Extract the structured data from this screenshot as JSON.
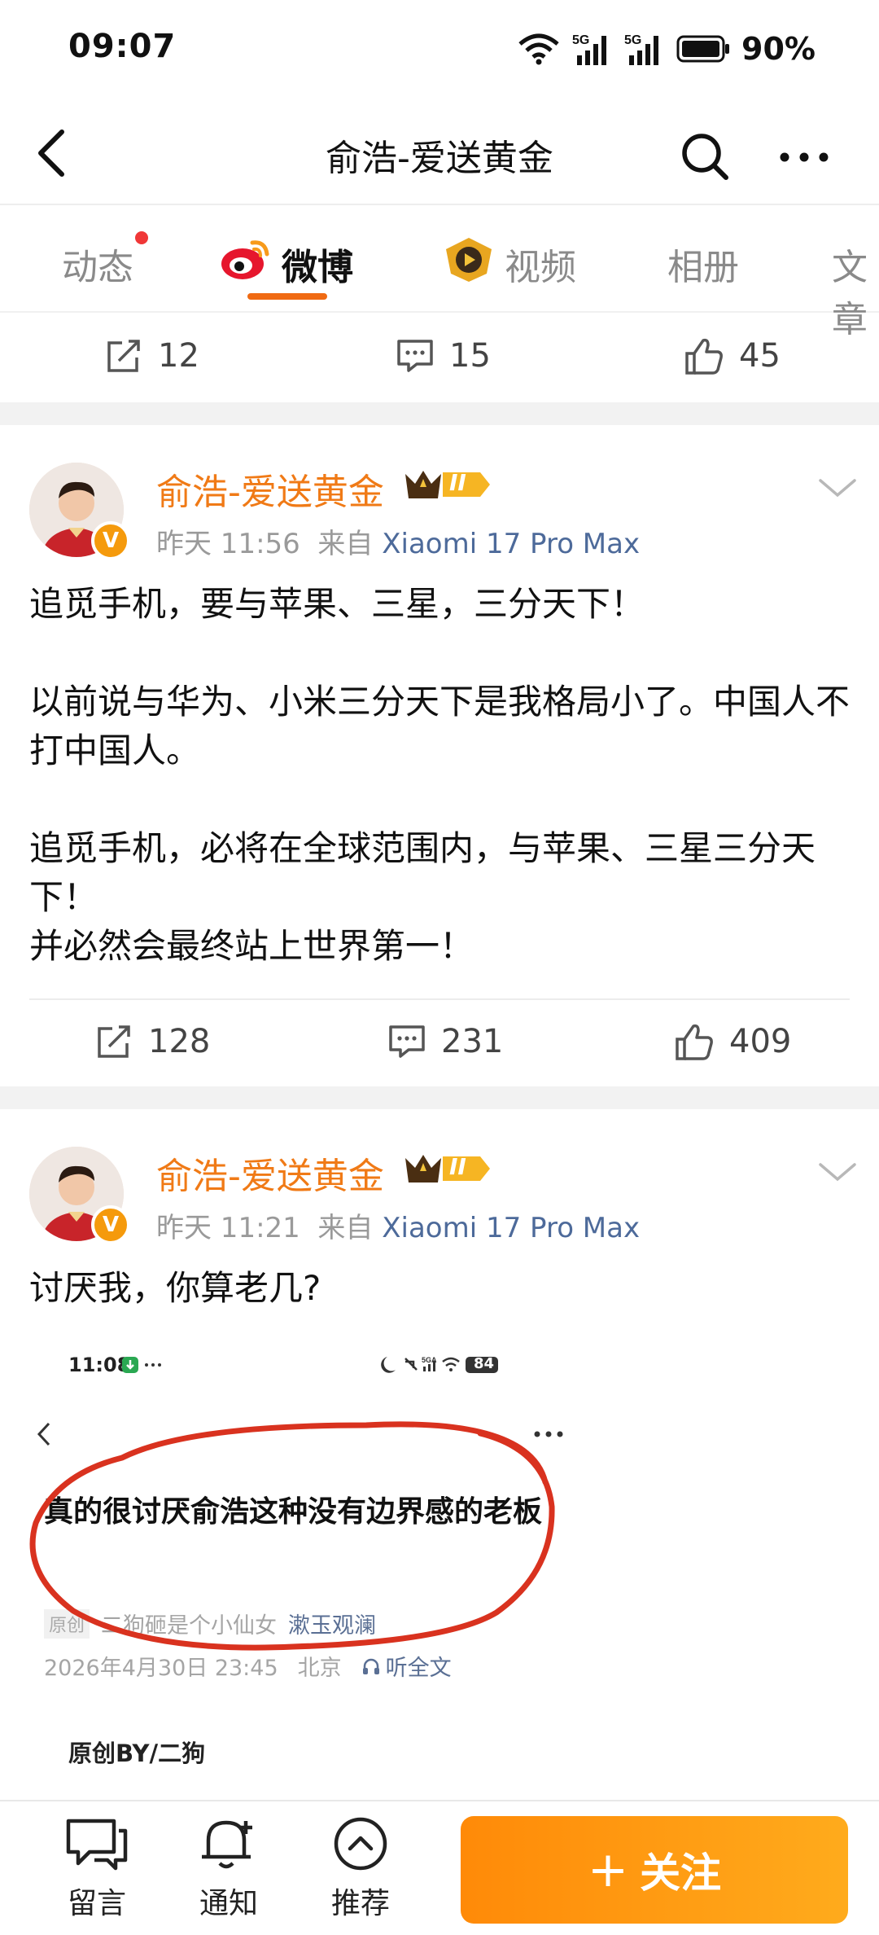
{
  "status_bar": {
    "time": "09:07",
    "battery": "90%",
    "signal_label": "5G"
  },
  "nav": {
    "title": "俞浩-爱送黄金"
  },
  "tabs": [
    {
      "label": "动态"
    },
    {
      "label": "微博"
    },
    {
      "label": "视频"
    },
    {
      "label": "相册"
    },
    {
      "label": "文章"
    }
  ],
  "top_actions": {
    "repost": "12",
    "comment": "15",
    "like": "45"
  },
  "posts": [
    {
      "author": "俞浩-爱送黄金",
      "level_badge": "II",
      "verified_mark": "V",
      "time": "昨天 11:56",
      "from_label": "来自",
      "source": "Xiaomi 17 Pro Max",
      "text": "追觅手机，要与苹果、三星，三分天下！\n\n以前说与华为、小米三分天下是我格局小了。中国人不打中国人。\n\n追觅手机，必将在全球范围内，与苹果、三星三分天下！\n并必然会最终站上世界第一！",
      "repost": "128",
      "comment": "231",
      "like": "409"
    },
    {
      "author": "俞浩-爱送黄金",
      "level_badge": "II",
      "verified_mark": "V",
      "time": "昨天 11:21",
      "from_label": "来自",
      "source": "Xiaomi 17 Pro Max",
      "text": "讨厌我，你算老几?",
      "embed": {
        "status_time": "11:08",
        "status_battery": "84",
        "title": "真的很讨厌俞浩这种没有边界感的老板",
        "tag": "原创",
        "writer": "二狗砸是个小仙女",
        "account": "漱玉观澜",
        "date": "2026年4月30日 23:45",
        "location": "北京",
        "listen": "听全文",
        "by_line": "原创BY/二狗"
      }
    }
  ],
  "bottom_bar": {
    "comment_label": "留言",
    "notify_label": "通知",
    "recommend_label": "推荐",
    "follow_label": "关注",
    "follow_plus": "+"
  },
  "colors": {
    "accent": "#f07a16",
    "follow_gradient_start": "#ff8a08",
    "follow_gradient_end": "#ffab1c",
    "source_link": "#4d6a9a",
    "annotation_red": "#d9321f"
  }
}
